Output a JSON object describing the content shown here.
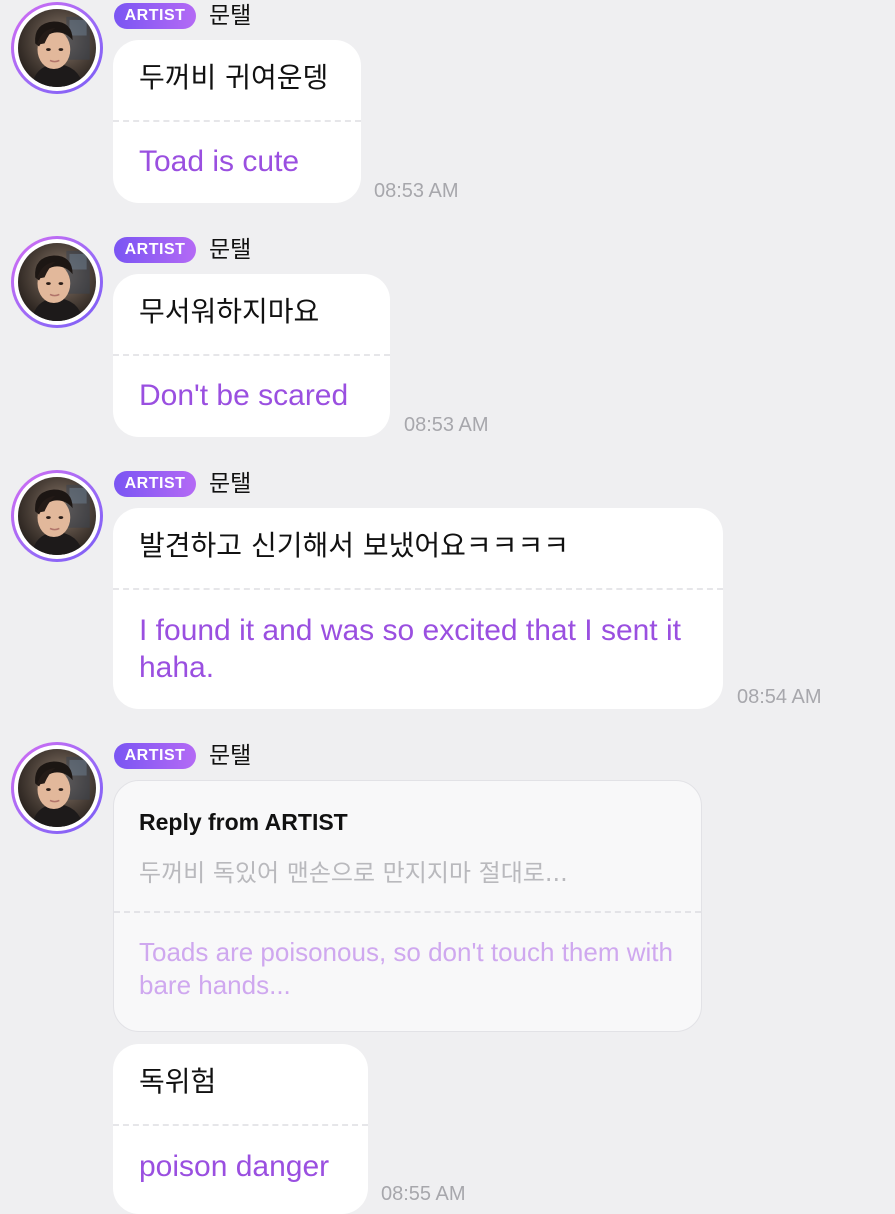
{
  "colors": {
    "background": "#efeff1",
    "bubble": "#ffffff",
    "translation_text": "#9a4fe0",
    "badge_gradient_start": "#7a55f3",
    "badge_gradient_end": "#b46af5",
    "timestamp": "#a7a7ac"
  },
  "sender": {
    "badge": "ARTIST",
    "name": "문탤",
    "avatar_icon": "profile-photo"
  },
  "messages": [
    {
      "korean": "두꺼비 귀여운뎅",
      "translation": "Toad is cute",
      "time": "08:53 AM"
    },
    {
      "korean": "무서워하지마요",
      "translation": "Don't be scared",
      "time": "08:53 AM"
    },
    {
      "korean": "발견하고 신기해서 보냈어요ㅋㅋㅋㅋ",
      "translation": "I found it and was so excited that I sent it haha.",
      "time": "08:54 AM"
    },
    {
      "reply": {
        "title": "Reply from ARTIST",
        "korean": "두꺼비 독있어 맨손으로 만지지마 절대로...",
        "translation": "Toads are poisonous, so don't touch them with bare hands..."
      },
      "korean": "독위험",
      "translation": "poison danger",
      "time": "08:55 AM"
    }
  ]
}
